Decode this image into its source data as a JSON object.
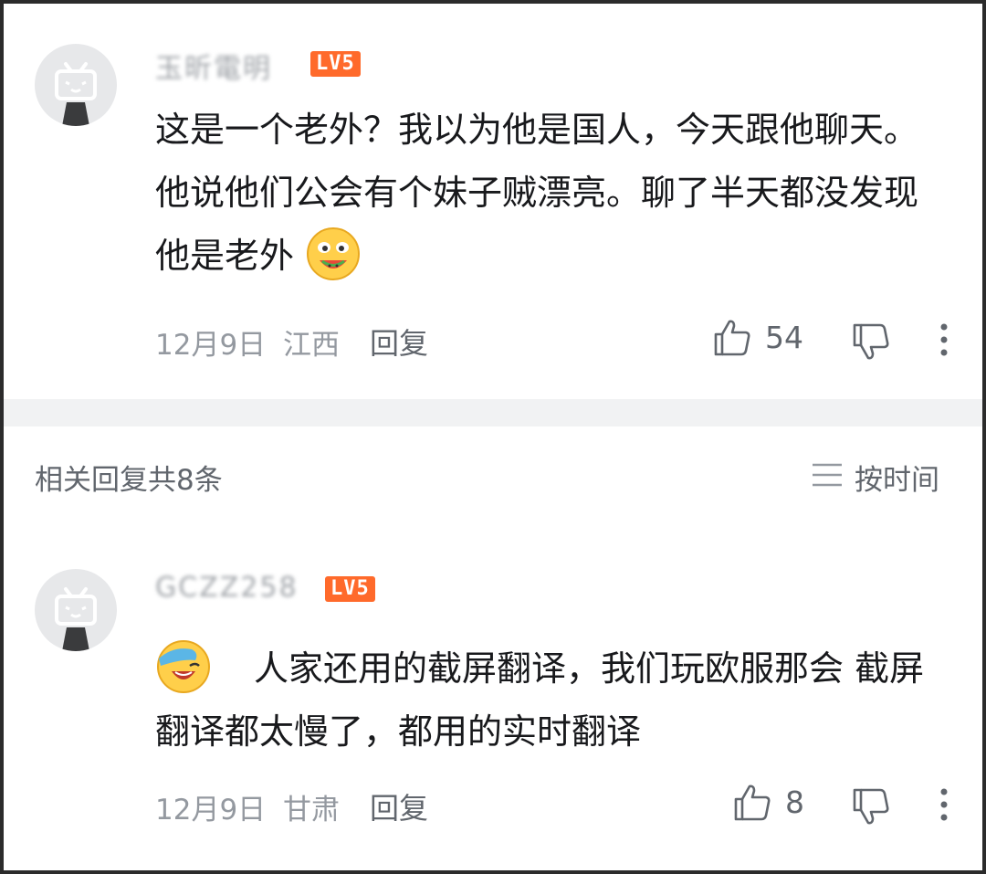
{
  "main_comment": {
    "username": "玉昕電明",
    "level": "LV5",
    "content": "这是一个老外？我以为他是国人，今天跟他聊天。他说他们公会有个妹子贼漂亮。聊了半天都没发现他是老外",
    "emoji": "watermelon-grin-emoji",
    "date": "12月9日",
    "location": "江西",
    "reply_label": "回复",
    "likes": "54"
  },
  "replies_header": {
    "count_label": "相关回复共8条",
    "sort_label": "按时间"
  },
  "reply_comment": {
    "username": "GCZZ258",
    "level": "LV5",
    "emoji": "facepalm-laugh-emoji",
    "content": "人家还用的截屏翻译，我们玩欧服那会 截屏翻译都太慢了，都用的实时翻译",
    "date": "12月9日",
    "location": "甘肃",
    "reply_label": "回复",
    "likes": "8"
  },
  "colors": {
    "level_badge": "#ff6a2b",
    "divider": "#f1f2f3",
    "meta_text": "#9499a0",
    "content_text": "#18191c"
  }
}
